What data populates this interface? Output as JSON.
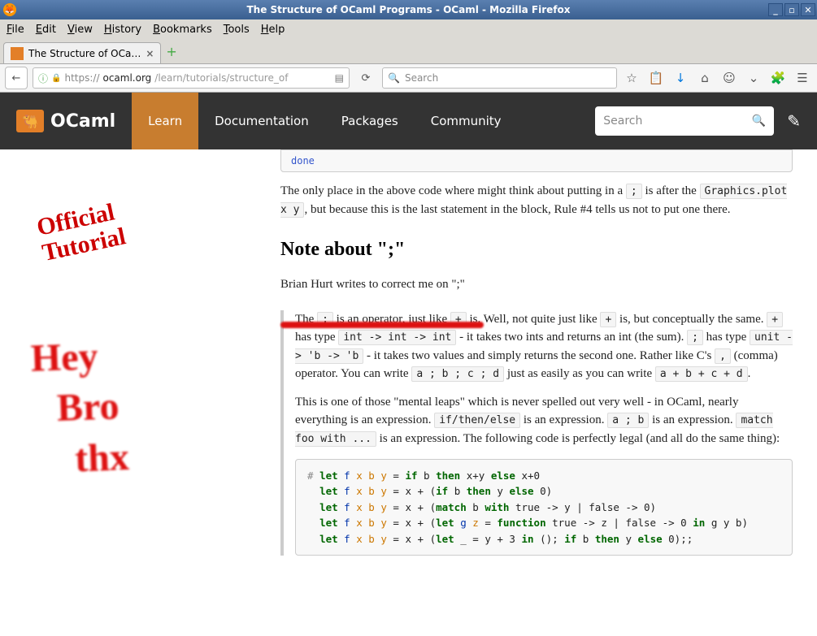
{
  "window": {
    "title": "The Structure of OCaml Programs - OCaml - Mozilla Firefox",
    "min": "_",
    "max": "▫",
    "close": "✕"
  },
  "menubar": {
    "items": [
      "File",
      "Edit",
      "View",
      "History",
      "Bookmarks",
      "Tools",
      "Help"
    ]
  },
  "tab": {
    "title": "The Structure of OCa…",
    "close": "×",
    "newtab": "+"
  },
  "toolbar": {
    "back": "←",
    "info": "ⓘ",
    "lock": "🔒",
    "url_proto": "https://",
    "url_domain": "ocaml.org",
    "url_path": "/learn/tutorials/structure_of",
    "reader": "▤",
    "reload": "⟳",
    "search_icon": "🔍",
    "search_placeholder": "Search",
    "star": "☆",
    "clipboard": "📋",
    "download": "↓",
    "home": "⌂",
    "pocket": "☺",
    "save": "⌄",
    "ext": "🧩",
    "hamburger": "☰"
  },
  "site": {
    "logo_icon": "🐫",
    "logo_text": "OCaml",
    "nav": [
      "Learn",
      "Documentation",
      "Packages",
      "Community"
    ],
    "search_placeholder": "Search",
    "search_icon": "🔍",
    "pencil": "✎"
  },
  "article": {
    "code_top": "done",
    "para1_a": "The only place in the above code where might think about putting in a ",
    "para1_code1": ";",
    "para1_b": " is after the ",
    "para1_code2": "Graphics.plot x y",
    "para1_c": ", but because this is the last statement in the block, Rule #4 tells us not to put one there.",
    "h2": "Note about \";\"",
    "para2": "Brian Hurt writes to correct me on \";\"",
    "q1_a": "The ",
    "q1_code1": ";",
    "q1_b": " is an operator, just like ",
    "q1_code2": "+",
    "q1_c": " is. Well, not quite just like ",
    "q1_code3": "+",
    "q1_d": " is, but conceptually the same. ",
    "q1_code4": "+",
    "q1_e": " has type ",
    "q1_code5": "int -> int -> int",
    "q1_f": " - it takes two ints and returns an int (the sum). ",
    "q1_code6": ";",
    "q1_g": " has type ",
    "q1_code7": "unit -> 'b -> 'b",
    "q1_h": " - it takes two values and simply returns the second one. Rather like C's ",
    "q1_code8": ",",
    "q1_i": " (comma) operator. You can write ",
    "q1_code9": "a ; b ; c ; d",
    "q1_j": " just as easily as you can write ",
    "q1_code10": "a + b + c + d",
    "q1_k": ".",
    "q2_a": "This is one of those \"mental leaps\" which is never spelled out very well - in OCaml, nearly everything is an expression. ",
    "q2_code1": "if/then/else",
    "q2_b": " is an expression. ",
    "q2_code2": "a ; b",
    "q2_c": " is an expression. ",
    "q2_code3": "match foo with ...",
    "q2_d": " is an expression. The following code is perfectly legal (and all do the same thing):"
  },
  "annotations": {
    "stamp_l1": "Official",
    "stamp_l2": "Tutorial",
    "scribble_l1": "Hey",
    "scribble_l2": "Bro",
    "scribble_l3": "thx"
  }
}
